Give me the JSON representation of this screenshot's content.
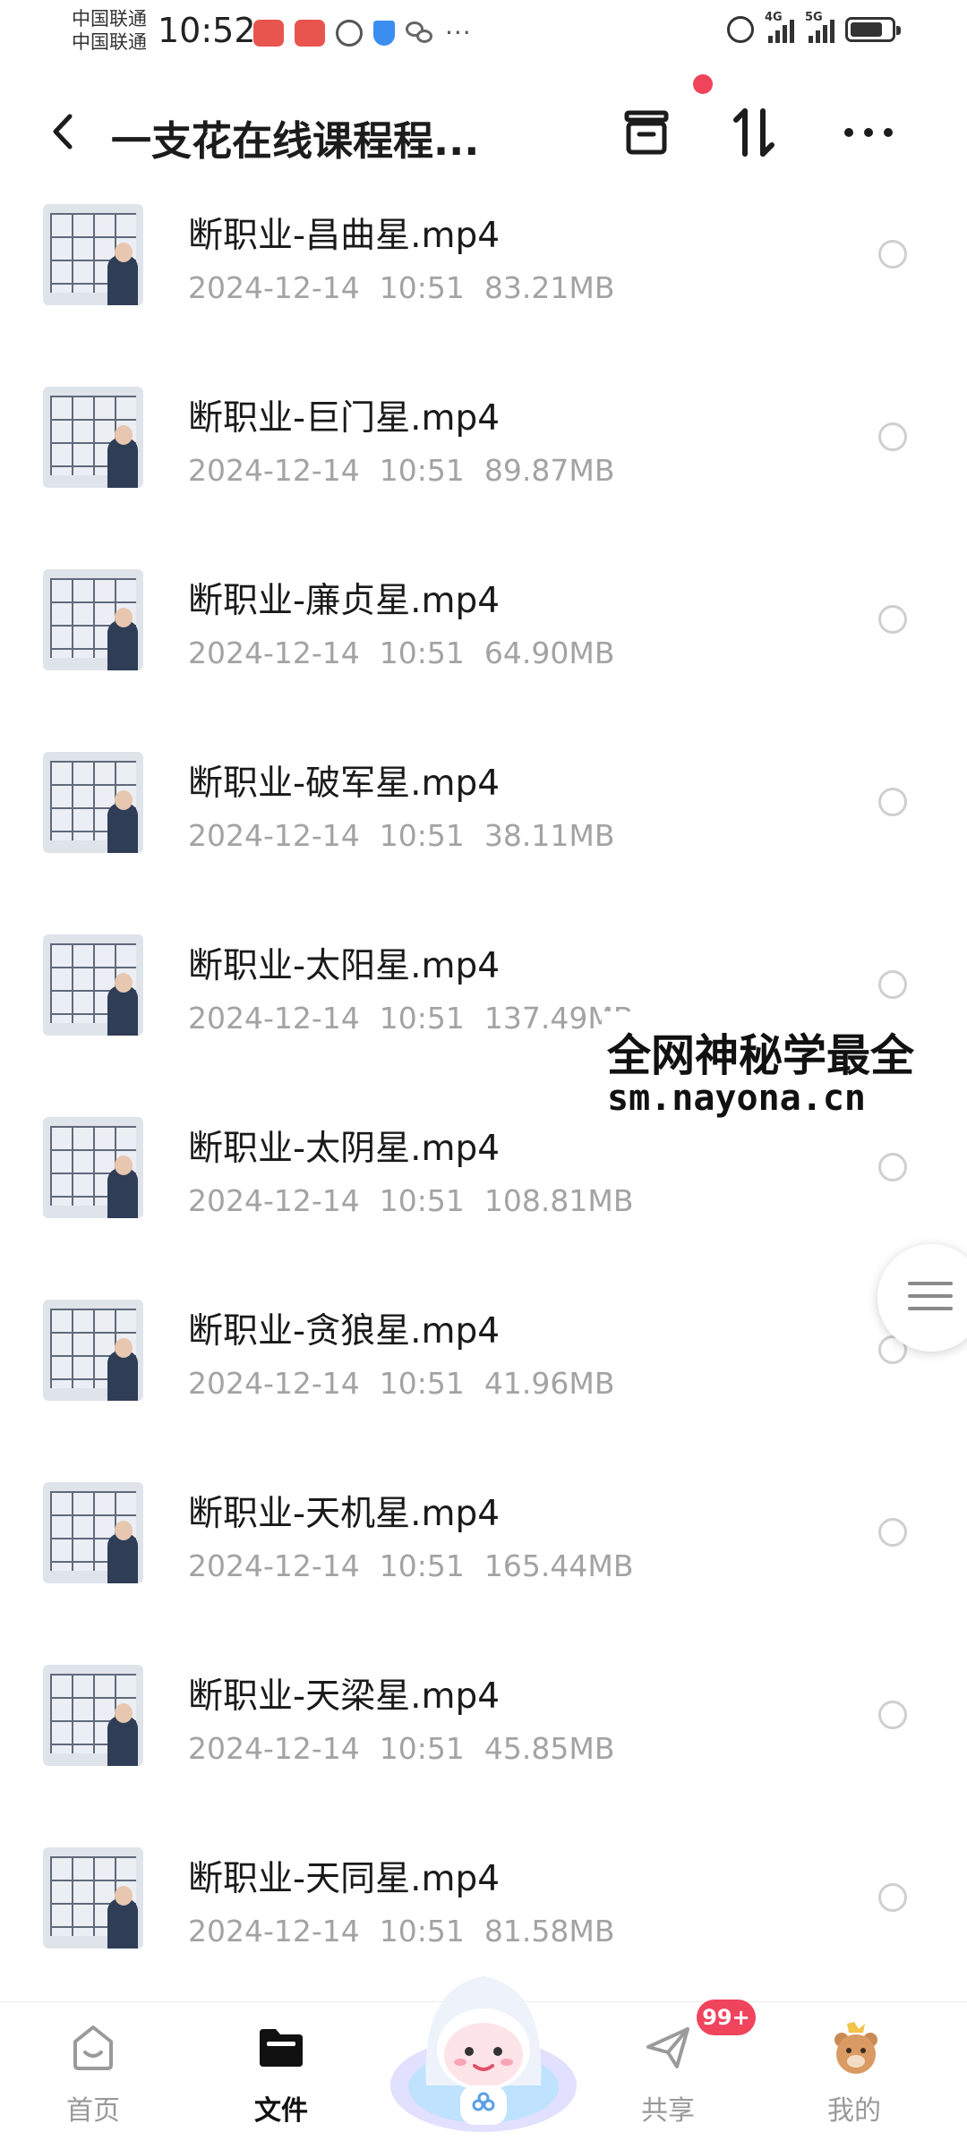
{
  "status_bar": {
    "carrier_1": "中国联通",
    "carrier_2": "中国联通",
    "time": "10:52",
    "more": "···",
    "signal_1": "4G",
    "signal_2": "5G"
  },
  "header": {
    "title": "一支花在线课程程...",
    "icons": [
      "back-icon",
      "archive-icon",
      "sort-icon",
      "more-icon"
    ],
    "notification_dot": true
  },
  "files": [
    {
      "name": "断职业-昌曲星.mp4",
      "date": "2024-12-14",
      "time": "10:51",
      "size": "83.21MB"
    },
    {
      "name": "断职业-巨门星.mp4",
      "date": "2024-12-14",
      "time": "10:51",
      "size": "89.87MB"
    },
    {
      "name": "断职业-廉贞星.mp4",
      "date": "2024-12-14",
      "time": "10:51",
      "size": "64.90MB"
    },
    {
      "name": "断职业-破军星.mp4",
      "date": "2024-12-14",
      "time": "10:51",
      "size": "38.11MB"
    },
    {
      "name": "断职业-太阳星.mp4",
      "date": "2024-12-14",
      "time": "10:51",
      "size": "137.49MB"
    },
    {
      "name": "断职业-太阴星.mp4",
      "date": "2024-12-14",
      "time": "10:51",
      "size": "108.81MB"
    },
    {
      "name": "断职业-贪狼星.mp4",
      "date": "2024-12-14",
      "time": "10:51",
      "size": "41.96MB"
    },
    {
      "name": "断职业-天机星.mp4",
      "date": "2024-12-14",
      "time": "10:51",
      "size": "165.44MB"
    },
    {
      "name": "断职业-天梁星.mp4",
      "date": "2024-12-14",
      "time": "10:51",
      "size": "45.85MB"
    },
    {
      "name": "断职业-天同星.mp4",
      "date": "2024-12-14",
      "time": "10:51",
      "size": "81.58MB"
    }
  ],
  "watermark": {
    "line1": "全网神秘学最全",
    "line2": "sm.nayona.cn"
  },
  "bottom_nav": {
    "items": [
      {
        "label": "首页",
        "icon": "home-icon",
        "active": false
      },
      {
        "label": "文件",
        "icon": "folder-icon",
        "active": true
      },
      {
        "label": "共享",
        "icon": "share-icon",
        "active": false
      },
      {
        "label": "我的",
        "icon": "profile-icon",
        "active": false
      }
    ],
    "share_badge": "99+"
  },
  "colors": {
    "accent_red": "#f0435c",
    "meta_gray": "#a3a3a3",
    "text": "#1a1a1a"
  }
}
